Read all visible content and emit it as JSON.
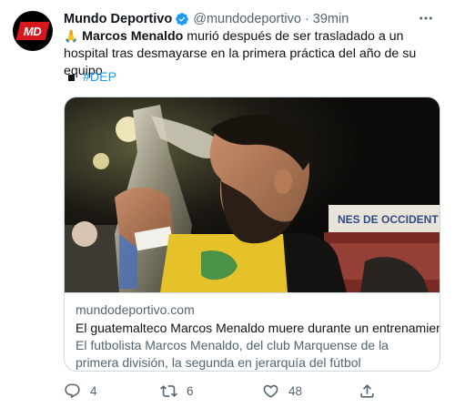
{
  "author": {
    "name": "Mundo Deportivo",
    "handle": "@mundodeportivo",
    "separator": "·",
    "time": "39min",
    "avatar_text": "MD"
  },
  "tweet": {
    "emoji": "🙏",
    "bold_name": "Marcos Menaldo",
    "text_rest": " murió después de ser trasladado a un hospital tras desmayarse en la primera práctica del año de su equipo",
    "hashtag": "#DEP"
  },
  "card": {
    "image_banner_text": "NES DE OCCIDENT",
    "domain": "mundodeportivo.com",
    "title": "El guatemalteco Marcos Menaldo muere durante un entrenamiento",
    "description": "El futbolista Marcos Menaldo, del club Marquense de la primera división, la segunda en jerarquía del fútbol guatemalteco, falleció este ..."
  },
  "actions": {
    "replies": "4",
    "retweets": "6",
    "likes": "48"
  },
  "icons": {
    "verified": "verified-badge-icon",
    "more": "more-options-icon",
    "reply": "reply-icon",
    "retweet": "retweet-icon",
    "like": "heart-icon",
    "share": "share-icon"
  },
  "colors": {
    "link_blue": "#1d9bf0",
    "secondary_text": "#536471",
    "brand_red": "#d7191f"
  }
}
